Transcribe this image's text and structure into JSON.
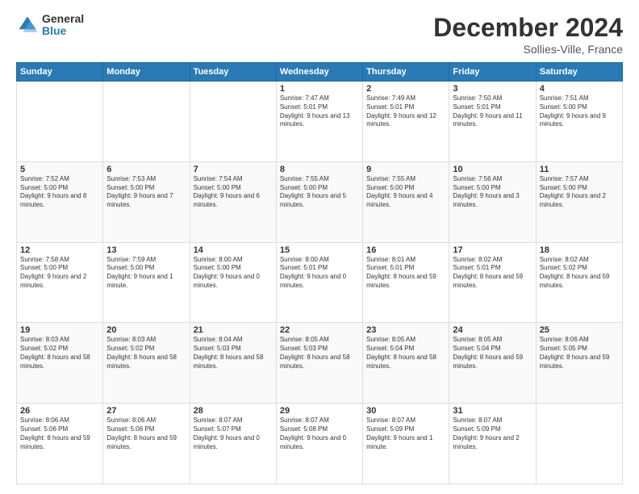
{
  "logo": {
    "general": "General",
    "blue": "Blue"
  },
  "header": {
    "month": "December 2024",
    "location": "Sollies-Ville, France"
  },
  "weekdays": [
    "Sunday",
    "Monday",
    "Tuesday",
    "Wednesday",
    "Thursday",
    "Friday",
    "Saturday"
  ],
  "days": [
    {
      "date": "",
      "info": ""
    },
    {
      "date": "",
      "info": ""
    },
    {
      "date": "",
      "info": ""
    },
    {
      "date": "1",
      "info": "Sunrise: 7:47 AM\nSunset: 5:01 PM\nDaylight: 9 hours and 13 minutes."
    },
    {
      "date": "2",
      "info": "Sunrise: 7:49 AM\nSunset: 5:01 PM\nDaylight: 9 hours and 12 minutes."
    },
    {
      "date": "3",
      "info": "Sunrise: 7:50 AM\nSunset: 5:01 PM\nDaylight: 9 hours and 11 minutes."
    },
    {
      "date": "4",
      "info": "Sunrise: 7:51 AM\nSunset: 5:00 PM\nDaylight: 9 hours and 9 minutes."
    },
    {
      "date": "5",
      "info": "Sunrise: 7:52 AM\nSunset: 5:00 PM\nDaylight: 9 hours and 8 minutes."
    },
    {
      "date": "6",
      "info": "Sunrise: 7:53 AM\nSunset: 5:00 PM\nDaylight: 9 hours and 7 minutes."
    },
    {
      "date": "7",
      "info": "Sunrise: 7:54 AM\nSunset: 5:00 PM\nDaylight: 9 hours and 6 minutes."
    },
    {
      "date": "8",
      "info": "Sunrise: 7:55 AM\nSunset: 5:00 PM\nDaylight: 9 hours and 5 minutes."
    },
    {
      "date": "9",
      "info": "Sunrise: 7:55 AM\nSunset: 5:00 PM\nDaylight: 9 hours and 4 minutes."
    },
    {
      "date": "10",
      "info": "Sunrise: 7:56 AM\nSunset: 5:00 PM\nDaylight: 9 hours and 3 minutes."
    },
    {
      "date": "11",
      "info": "Sunrise: 7:57 AM\nSunset: 5:00 PM\nDaylight: 9 hours and 2 minutes."
    },
    {
      "date": "12",
      "info": "Sunrise: 7:58 AM\nSunset: 5:00 PM\nDaylight: 9 hours and 2 minutes."
    },
    {
      "date": "13",
      "info": "Sunrise: 7:59 AM\nSunset: 5:00 PM\nDaylight: 9 hours and 1 minute."
    },
    {
      "date": "14",
      "info": "Sunrise: 8:00 AM\nSunset: 5:00 PM\nDaylight: 9 hours and 0 minutes."
    },
    {
      "date": "15",
      "info": "Sunrise: 8:00 AM\nSunset: 5:01 PM\nDaylight: 9 hours and 0 minutes."
    },
    {
      "date": "16",
      "info": "Sunrise: 8:01 AM\nSunset: 5:01 PM\nDaylight: 8 hours and 59 minutes."
    },
    {
      "date": "17",
      "info": "Sunrise: 8:02 AM\nSunset: 5:01 PM\nDaylight: 8 hours and 59 minutes."
    },
    {
      "date": "18",
      "info": "Sunrise: 8:02 AM\nSunset: 5:02 PM\nDaylight: 8 hours and 59 minutes."
    },
    {
      "date": "19",
      "info": "Sunrise: 8:03 AM\nSunset: 5:02 PM\nDaylight: 8 hours and 58 minutes."
    },
    {
      "date": "20",
      "info": "Sunrise: 8:03 AM\nSunset: 5:02 PM\nDaylight: 8 hours and 58 minutes."
    },
    {
      "date": "21",
      "info": "Sunrise: 8:04 AM\nSunset: 5:03 PM\nDaylight: 8 hours and 58 minutes."
    },
    {
      "date": "22",
      "info": "Sunrise: 8:05 AM\nSunset: 5:03 PM\nDaylight: 8 hours and 58 minutes."
    },
    {
      "date": "23",
      "info": "Sunrise: 8:05 AM\nSunset: 5:04 PM\nDaylight: 8 hours and 58 minutes."
    },
    {
      "date": "24",
      "info": "Sunrise: 8:05 AM\nSunset: 5:04 PM\nDaylight: 8 hours and 59 minutes."
    },
    {
      "date": "25",
      "info": "Sunrise: 8:06 AM\nSunset: 5:05 PM\nDaylight: 8 hours and 59 minutes."
    },
    {
      "date": "26",
      "info": "Sunrise: 8:06 AM\nSunset: 5:06 PM\nDaylight: 8 hours and 59 minutes."
    },
    {
      "date": "27",
      "info": "Sunrise: 8:06 AM\nSunset: 5:06 PM\nDaylight: 8 hours and 59 minutes."
    },
    {
      "date": "28",
      "info": "Sunrise: 8:07 AM\nSunset: 5:07 PM\nDaylight: 9 hours and 0 minutes."
    },
    {
      "date": "29",
      "info": "Sunrise: 8:07 AM\nSunset: 5:08 PM\nDaylight: 9 hours and 0 minutes."
    },
    {
      "date": "30",
      "info": "Sunrise: 8:07 AM\nSunset: 5:09 PM\nDaylight: 9 hours and 1 minute."
    },
    {
      "date": "31",
      "info": "Sunrise: 8:07 AM\nSunset: 5:09 PM\nDaylight: 9 hours and 2 minutes."
    },
    {
      "date": "",
      "info": ""
    },
    {
      "date": "",
      "info": ""
    },
    {
      "date": "",
      "info": ""
    },
    {
      "date": "",
      "info": ""
    },
    {
      "date": "",
      "info": ""
    }
  ]
}
